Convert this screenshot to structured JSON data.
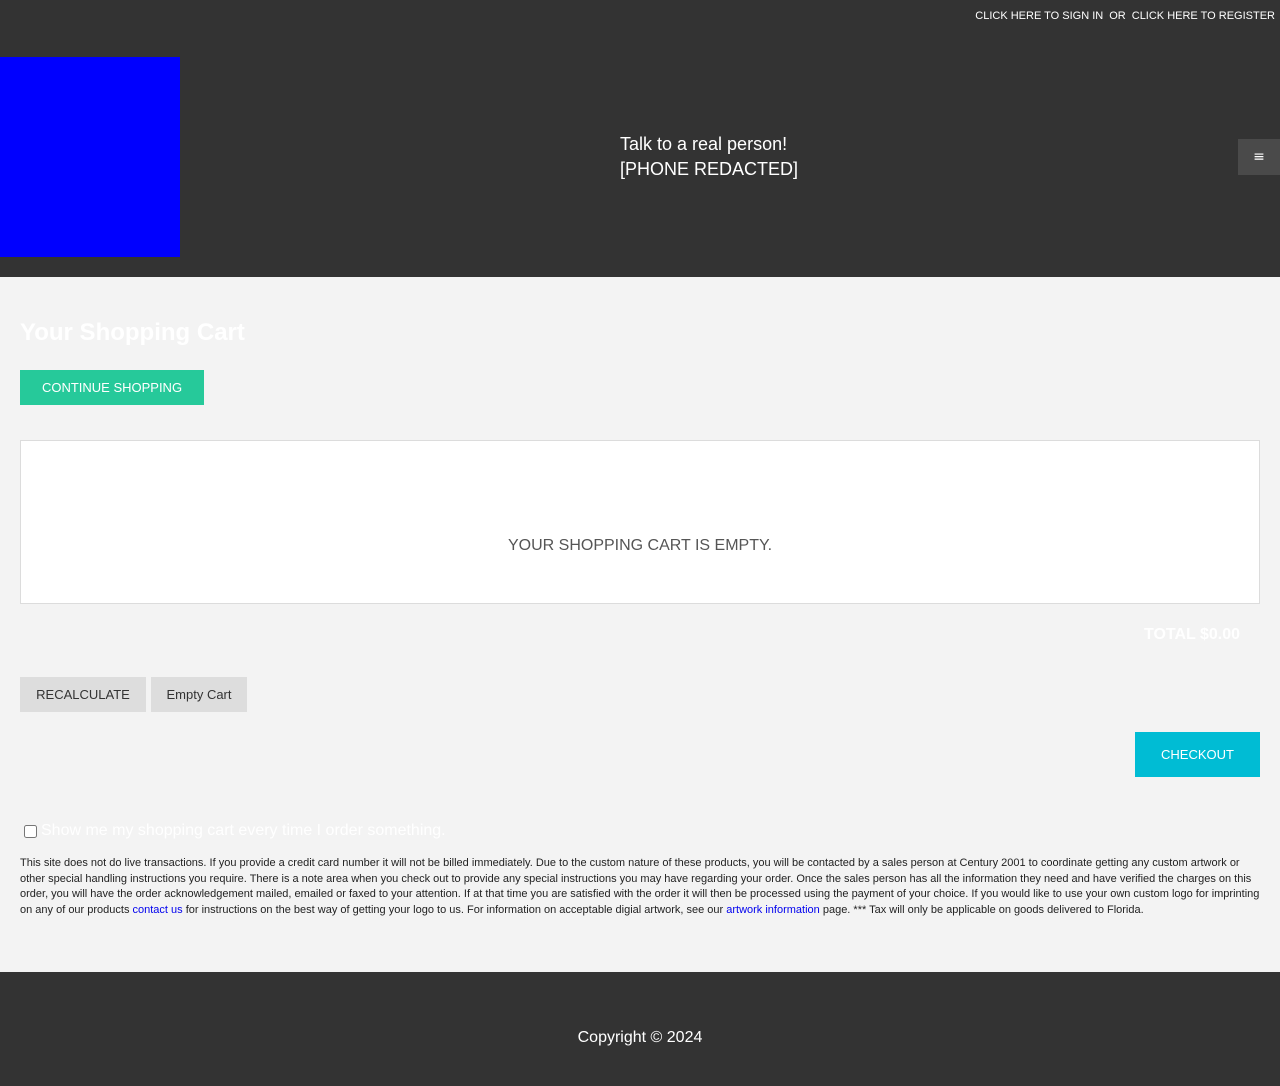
{
  "header": {
    "auth": {
      "sign_in": "CLICK HERE TO SIGN IN",
      "or": "OR",
      "register": "CLICK HERE TO REGISTER"
    },
    "talk_line1": "Talk to a real person!",
    "talk_line2": "[PHONE REDACTED]",
    "menu_icon": "≡"
  },
  "cart": {
    "title": "Your Shopping Cart",
    "continue_label": "CONTINUE SHOPPING",
    "empty_message": "YOUR SHOPPING CART IS EMPTY.",
    "total": "TOTAL $0.00",
    "recalculate_label": "RECALCULATE",
    "empty_cart_label": "Empty Cart",
    "checkout_label": "CHECKOUT",
    "show_cart_label": "Show me my shopping cart every time I order something."
  },
  "notice": {
    "text1": "This site does not do live transactions. If you provide a credit card number it will not be billed immediately. Due to the custom nature of these products, you will be contacted by a sales person at Century 2001 to coordinate getting any custom artwork or other special handling instructions you require. There is a note area when you check out to provide any special instructions you may have regarding your order. Once the sales person has all the information they need and have verified the charges on this order, you will have the order acknowledgement mailed, emailed or faxed to your attention. If at that time you are satisfied with the order it will then be processed using the payment of your choice. If you would like to use your own custom logo for imprinting on any of our products ",
    "contact_link": "contact us",
    "text2": " for instructions on the best way of getting your logo to us. For information on acceptable digial artwork, see our ",
    "artwork_link": "artwork information",
    "text3": " page. *** Tax will only be applicable on goods delivered to Florida."
  },
  "footer": {
    "copyright": "Copyright © 2024"
  },
  "colors": {
    "header_bg": "#333333",
    "logo": "#0000ff",
    "continue_button": "#26c99a",
    "checkout_button": "#00bcd4",
    "link": "#0000ee"
  }
}
